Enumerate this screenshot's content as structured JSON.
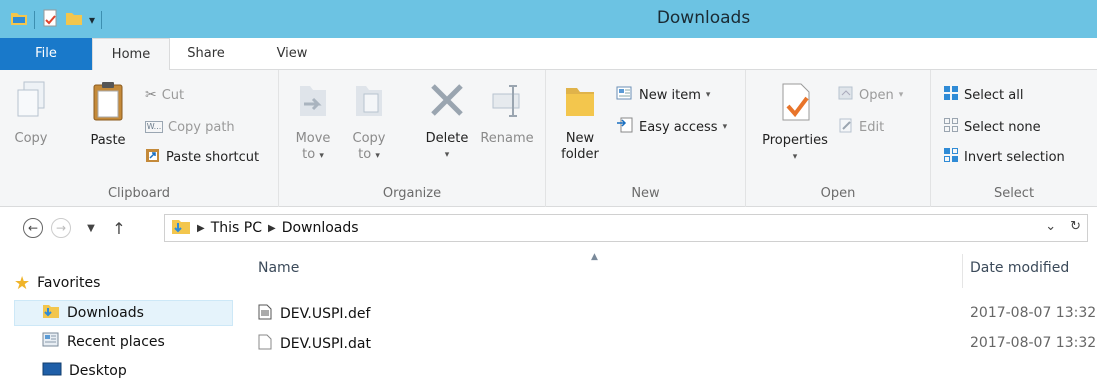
{
  "window": {
    "title": "Downloads"
  },
  "tabs": [
    {
      "label": "File"
    },
    {
      "label": "Home"
    },
    {
      "label": "Share"
    },
    {
      "label": "View"
    }
  ],
  "ribbon": {
    "clipboard": {
      "label": "Clipboard",
      "copy": "Copy",
      "paste": "Paste",
      "cut": "Cut",
      "copy_path": "Copy path",
      "paste_shortcut": "Paste shortcut"
    },
    "organize": {
      "label": "Organize",
      "move_to": [
        "Move",
        "to"
      ],
      "copy_to": [
        "Copy",
        "to"
      ],
      "delete": "Delete",
      "rename": "Rename"
    },
    "new": {
      "label": "New",
      "new_folder": [
        "New",
        "folder"
      ],
      "new_item": "New item",
      "easy_access": "Easy access"
    },
    "open": {
      "label": "Open",
      "properties": "Properties",
      "open": "Open",
      "edit": "Edit"
    },
    "select": {
      "label": "Select",
      "select_all": "Select all",
      "select_none": "Select none",
      "invert_selection": "Invert selection"
    }
  },
  "address": {
    "breadcrumbs": [
      "This PC",
      "Downloads"
    ]
  },
  "nav": {
    "favorites": "Favorites",
    "items": [
      {
        "label": "Downloads",
        "selected": true
      },
      {
        "label": "Recent places"
      },
      {
        "label": "Desktop"
      }
    ]
  },
  "columns": {
    "name": "Name",
    "date": "Date modified"
  },
  "files": [
    {
      "name": "DEV.USPI.def",
      "date": "2017-08-07 13:32"
    },
    {
      "name": "DEV.USPI.dat",
      "date": "2017-08-07 13:32"
    }
  ],
  "colors": {
    "titlebar": "#6cc3e3",
    "file_tab": "#1979ca",
    "ribbon_bg": "#f5f6f7",
    "selection": "#e5f3fb"
  }
}
